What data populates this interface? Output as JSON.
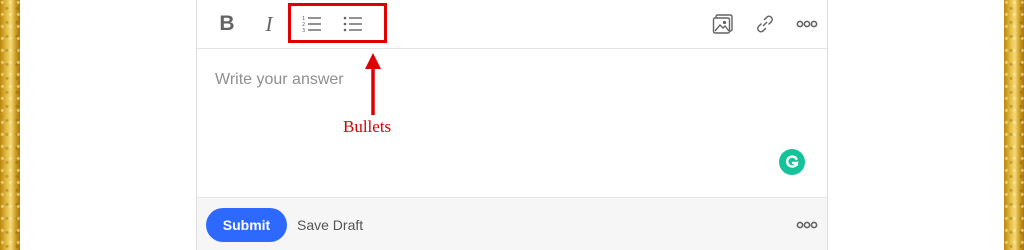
{
  "toolbar": {
    "bold_label": "B",
    "italic_label": "I",
    "icons": [
      "ordered-list-icon",
      "bulleted-list-icon",
      "image-icon",
      "link-icon",
      "more-icon"
    ]
  },
  "editor": {
    "placeholder": "Write your answer"
  },
  "annotation": {
    "label": "Bullets",
    "color": "#e00000"
  },
  "footer": {
    "submit_label": "Submit",
    "save_draft_label": "Save Draft"
  },
  "colors": {
    "accent": "#2e69ff",
    "grammarly": "#15c39a",
    "annotation_red": "#e00000",
    "border_gold": "#d4a62a"
  }
}
